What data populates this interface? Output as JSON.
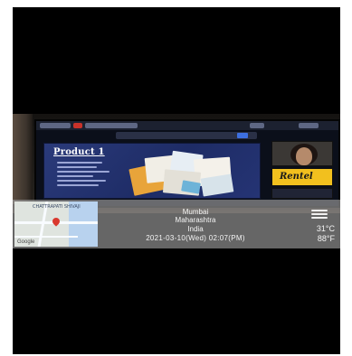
{
  "slide": {
    "title": "Product 1"
  },
  "logo_tile": {
    "text": "Rentel"
  },
  "map": {
    "label": "CHATTRAPATI SHIVAJI",
    "provider": "Google"
  },
  "location": {
    "city": "Mumbai",
    "state": "Maharashtra",
    "country": "India",
    "datetime": "2021-03-10(Wed)  02:07(PM)"
  },
  "weather": {
    "icon": "haze-icon",
    "temp_c": "31°C",
    "temp_f": "88°F"
  },
  "colors": {
    "slide_bg": "#253474",
    "logo_bg": "#f2c01e",
    "overlay": "#969696"
  }
}
